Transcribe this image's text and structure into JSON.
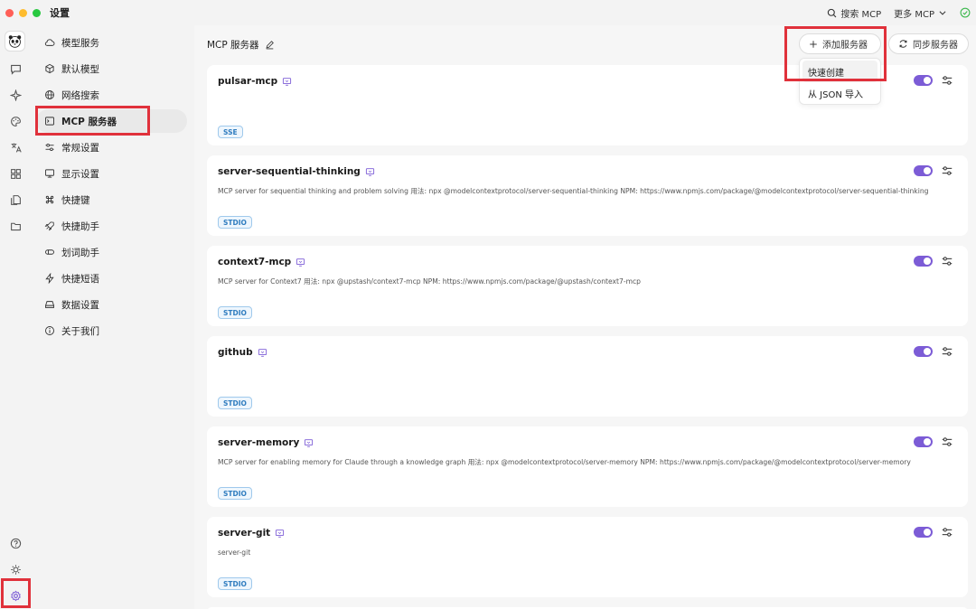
{
  "window": {
    "title": "设置"
  },
  "titlebar": {
    "search_label": "搜索 MCP",
    "more_label": "更多 MCP"
  },
  "sidebar": {
    "items": [
      {
        "label": "模型服务",
        "icon": "cloud-icon"
      },
      {
        "label": "默认模型",
        "icon": "cube-icon"
      },
      {
        "label": "网络搜索",
        "icon": "globe-icon"
      },
      {
        "label": "MCP 服务器",
        "icon": "terminal-icon",
        "active": true
      },
      {
        "label": "常规设置",
        "icon": "sliders-icon"
      },
      {
        "label": "显示设置",
        "icon": "monitor-icon"
      },
      {
        "label": "快捷键",
        "icon": "command-icon"
      },
      {
        "label": "快捷助手",
        "icon": "rocket-icon"
      },
      {
        "label": "划词助手",
        "icon": "highlighter-icon"
      },
      {
        "label": "快捷短语",
        "icon": "zap-icon"
      },
      {
        "label": "数据设置",
        "icon": "drive-icon"
      },
      {
        "label": "关于我们",
        "icon": "info-icon"
      }
    ]
  },
  "main": {
    "title": "MCP 服务器",
    "add_label": "添加服务器",
    "sync_label": "同步服务器",
    "dropdown": [
      "快速创建",
      "从 JSON 导入"
    ]
  },
  "servers": [
    {
      "name": "pulsar-mcp",
      "desc": "",
      "tag": "SSE",
      "enabled": true
    },
    {
      "name": "server-sequential-thinking",
      "desc": "MCP server for sequential thinking and problem solving 用法: npx @modelcontextprotocol/server-sequential-thinking NPM: https://www.npmjs.com/package/@modelcontextprotocol/server-sequential-thinking",
      "tag": "STDIO",
      "enabled": true
    },
    {
      "name": "context7-mcp",
      "desc": "MCP server for Context7 用法: npx @upstash/context7-mcp NPM: https://www.npmjs.com/package/@upstash/context7-mcp",
      "tag": "STDIO",
      "enabled": true
    },
    {
      "name": "github",
      "desc": "",
      "tag": "STDIO",
      "enabled": true
    },
    {
      "name": "server-memory",
      "desc": "MCP server for enabling memory for Claude through a knowledge graph 用法: npx @modelcontextprotocol/server-memory NPM: https://www.npmjs.com/package/@modelcontextprotocol/server-memory",
      "tag": "STDIO",
      "enabled": true
    },
    {
      "name": "server-git",
      "desc": "server-git",
      "tag": "STDIO",
      "enabled": true
    }
  ],
  "colors": {
    "accent": "#7c5cd6",
    "highlight": "#e0313b",
    "tag_text": "#2f7cbf"
  }
}
